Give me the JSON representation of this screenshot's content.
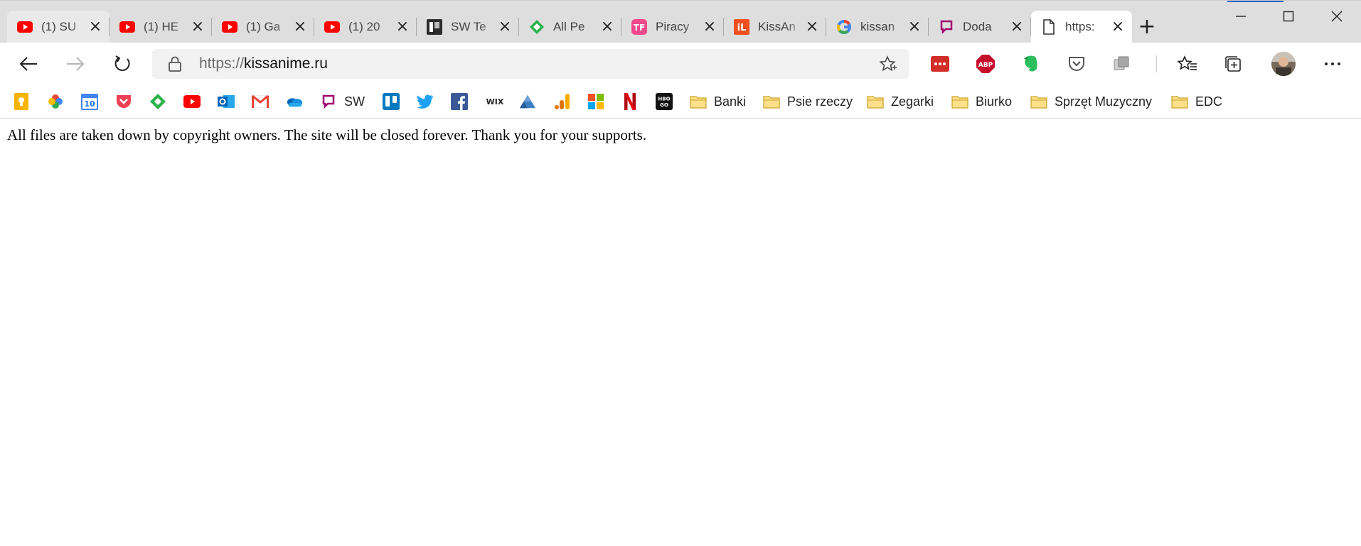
{
  "tabs": [
    {
      "title": "(1) SU",
      "icon": "youtube-icon",
      "active": false
    },
    {
      "title": "(1) HE",
      "icon": "youtube-icon",
      "active": false
    },
    {
      "title": "(1) Ga",
      "icon": "youtube-icon",
      "active": false
    },
    {
      "title": "(1) 20",
      "icon": "youtube-icon",
      "active": false
    },
    {
      "title": "SW Te",
      "icon": "sw-tech-icon",
      "active": false
    },
    {
      "title": "All Pe",
      "icon": "feedly-icon",
      "active": false
    },
    {
      "title": "Piracy",
      "icon": "tf-icon",
      "active": false
    },
    {
      "title": "KissAn",
      "icon": "il-icon",
      "active": false
    },
    {
      "title": "kissan",
      "icon": "google-icon",
      "active": false
    },
    {
      "title": "Doda",
      "icon": "sw-bookmark-icon",
      "active": false
    },
    {
      "title": "https:",
      "icon": "page-icon",
      "active": true
    }
  ],
  "address": {
    "protocol": "https://",
    "host": "kissanime.ru"
  },
  "extensions": [
    "lastpass-icon",
    "adblock-plus-icon",
    "evernote-icon",
    "pocket-icon",
    "extension-icon"
  ],
  "bookmarks": [
    {
      "label": "",
      "icon": "keep-icon"
    },
    {
      "label": "",
      "icon": "photos-icon"
    },
    {
      "label": "",
      "icon": "calendar-icon",
      "badge": "10"
    },
    {
      "label": "",
      "icon": "pocket-icon"
    },
    {
      "label": "",
      "icon": "feedly-icon"
    },
    {
      "label": "",
      "icon": "youtube-icon"
    },
    {
      "label": "",
      "icon": "outlook-icon"
    },
    {
      "label": "",
      "icon": "gmail-icon"
    },
    {
      "label": "",
      "icon": "onedrive-icon"
    },
    {
      "label": "SW",
      "icon": "sw-bookmark-icon"
    },
    {
      "label": "",
      "icon": "trello-icon"
    },
    {
      "label": "",
      "icon": "twitter-icon"
    },
    {
      "label": "",
      "icon": "facebook-icon"
    },
    {
      "label": "",
      "icon": "wix-icon",
      "badge": "WIX"
    },
    {
      "label": "",
      "icon": "drive-icon"
    },
    {
      "label": "",
      "icon": "analytics-icon"
    },
    {
      "label": "",
      "icon": "microsoft-icon"
    },
    {
      "label": "",
      "icon": "netflix-icon"
    },
    {
      "label": "",
      "icon": "hbo-go-icon",
      "badge": "HBO GO"
    },
    {
      "label": "Banki",
      "icon": "folder-icon"
    },
    {
      "label": "Psie rzeczy",
      "icon": "folder-icon"
    },
    {
      "label": "Zegarki",
      "icon": "folder-icon"
    },
    {
      "label": "Biurko",
      "icon": "folder-icon"
    },
    {
      "label": "Sprzęt Muzyczny",
      "icon": "folder-icon"
    },
    {
      "label": "EDC",
      "icon": "folder-icon"
    }
  ],
  "page": {
    "message": "All files are taken down by copyright owners. The site will be closed forever. Thank you for your supports."
  }
}
